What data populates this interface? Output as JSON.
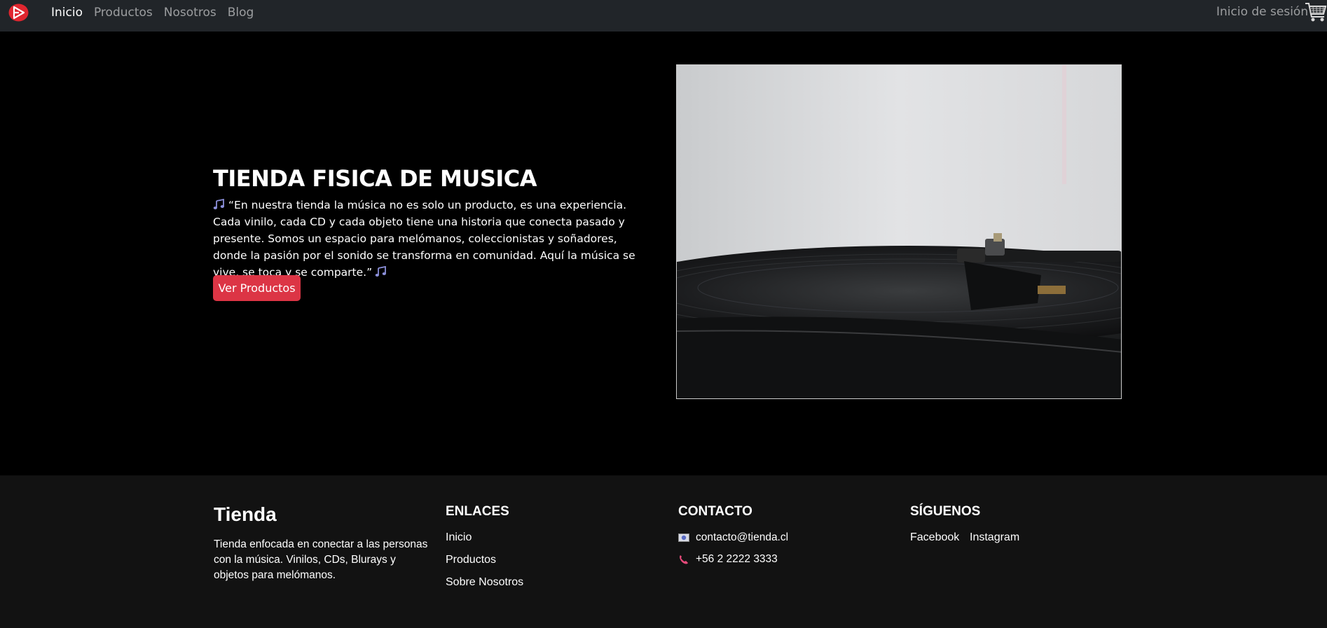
{
  "nav": {
    "logo_icon": "play-logo-icon",
    "links": [
      "Inicio",
      "Productos",
      "Nosotros",
      "Blog"
    ],
    "active": "Inicio",
    "login": "Inicio de sesión",
    "cart_icon": "shopping-cart-icon"
  },
  "hero": {
    "title": "TIENDA FISICA DE MUSICA",
    "text": "“En nuestra tienda la música no es solo un producto, es una experiencia. Cada vinilo, cada CD y cada objeto tiene una historia que conecta pasado y presente. Somos un espacio para melómanos, coleccionistas y soñadores, donde la pasión por el sonido se transforma en comunidad. Aquí la música se vive, se toca y se comparte.”",
    "button": "Ver Productos",
    "note_icon": "music-notes-icon",
    "image": "turntable-vinyl-photo"
  },
  "footer": {
    "brand": "Tienda",
    "description": "Tienda enfocada en conectar a las personas con la música. Vinilos, CDs, Blurays y objetos para melómanos.",
    "links_title": "ENLACES",
    "links": [
      "Inicio",
      "Productos",
      "Sobre Nosotros"
    ],
    "contact_title": "CONTACTO",
    "email": "contacto@tienda.cl",
    "phone": "+56 2 2222 3333",
    "social_title": "SÍGUENOS",
    "social": [
      "Facebook",
      "Instagram"
    ]
  },
  "colors": {
    "navbar_bg": "#212529",
    "hero_bg": "#000000",
    "footer_bg": "#121212",
    "button_bg": "#dc3545",
    "logo_red": "#e0262f"
  }
}
